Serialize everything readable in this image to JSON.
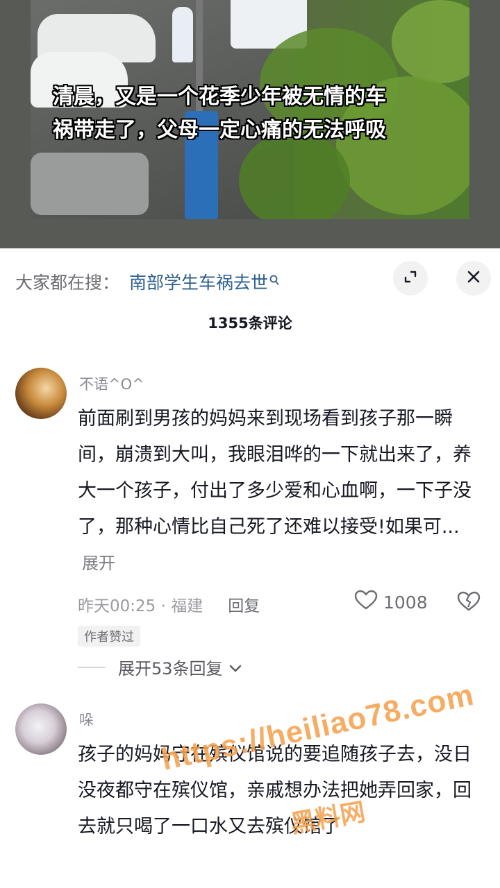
{
  "video": {
    "caption_line1": "清晨，又是一个花季少年被无情的车",
    "caption_line2": "祸带走了，父母一定心痛的无法呼吸"
  },
  "search_bar": {
    "prefix": "大家都在搜：",
    "term": "南部学生车祸去世",
    "icon": "search-icon"
  },
  "panel_buttons": {
    "expand_icon": "expand-icon",
    "close_icon": "close-icon"
  },
  "comments_header": {
    "count_label": "1355条评论"
  },
  "comments": [
    {
      "username": "不语^O^",
      "text": "前面刷到男孩的妈妈来到现场看到孩子那一瞬间，崩溃到大叫，我眼泪哗的一下就出来了，养大一个孩子，付出了多少爱和心血啊，一下子没了，那种心情比自己死了还难以接受!如果可...",
      "expand_label": "展开",
      "time_location": "昨天00:25 · 福建",
      "reply_label": "回复",
      "likes": "1008",
      "badge": "作者赞过",
      "replies_label": "展开53条回复"
    },
    {
      "username": "哚",
      "text": "孩子的妈妈守在殡仪馆说的要追随孩子去，没日没夜都守在殡仪馆，亲戚想办法把她弄回家，回去就只喝了一口水又去殡仪馆了"
    }
  ],
  "watermark": {
    "url": "https://heiliao78.com",
    "brand": "黑料网"
  },
  "colors": {
    "link_blue": "#2d5f8f",
    "watermark_orange": "#f5a14e",
    "meta_grey": "#9a9ba0"
  }
}
